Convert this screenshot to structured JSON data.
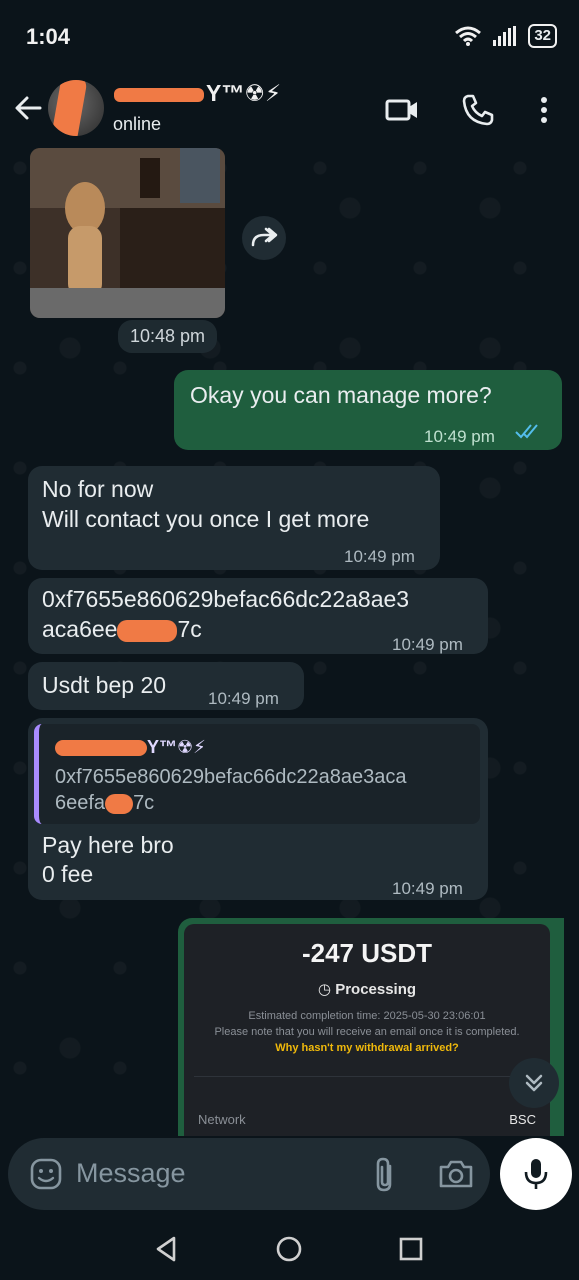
{
  "status_bar": {
    "time": "1:04",
    "battery": "32"
  },
  "header": {
    "contact_name_suffix": "Y™☢⚡",
    "contact_status": "online"
  },
  "messages": {
    "image_time": "10:48 pm",
    "m1": {
      "text": "Okay you can manage more?",
      "time": "10:49 pm"
    },
    "m2": {
      "line1": "No for now",
      "line2": "Will contact you once I get more",
      "time": "10:49 pm"
    },
    "m3": {
      "line1": "0xf7655e860629befac66dc22a8ae3",
      "line2_start": "aca6ee",
      "line2_end": "7c",
      "time": "10:49 pm"
    },
    "m4": {
      "text": "Usdt bep 20",
      "time": "10:49 pm"
    },
    "m5": {
      "quote_name_suffix": "Y™☢⚡",
      "quote_line1": "0xf7655e860629befac66dc22a8ae3aca",
      "quote_line2_start": "6eefa",
      "quote_line2_end": "7c",
      "line1": "Pay here bro",
      "line2": "0 fee",
      "time": "10:49 pm"
    }
  },
  "screenshot": {
    "amount": "-247 USDT",
    "status": "Processing",
    "note1": "Estimated completion time: 2025-05-30 23:06:01",
    "note2": "Please note that you will receive an email once it is completed.",
    "link": "Why hasn't my withdrawal arrived?",
    "network_label": "Network",
    "network_value": "BSC"
  },
  "composer": {
    "placeholder": "Message"
  },
  "colors": {
    "background": "#0b141a",
    "incoming_bubble": "#202c33",
    "outgoing_bubble": "#1f5e3e",
    "read_ticks": "#53bdeb",
    "redaction": "#f07a45"
  }
}
